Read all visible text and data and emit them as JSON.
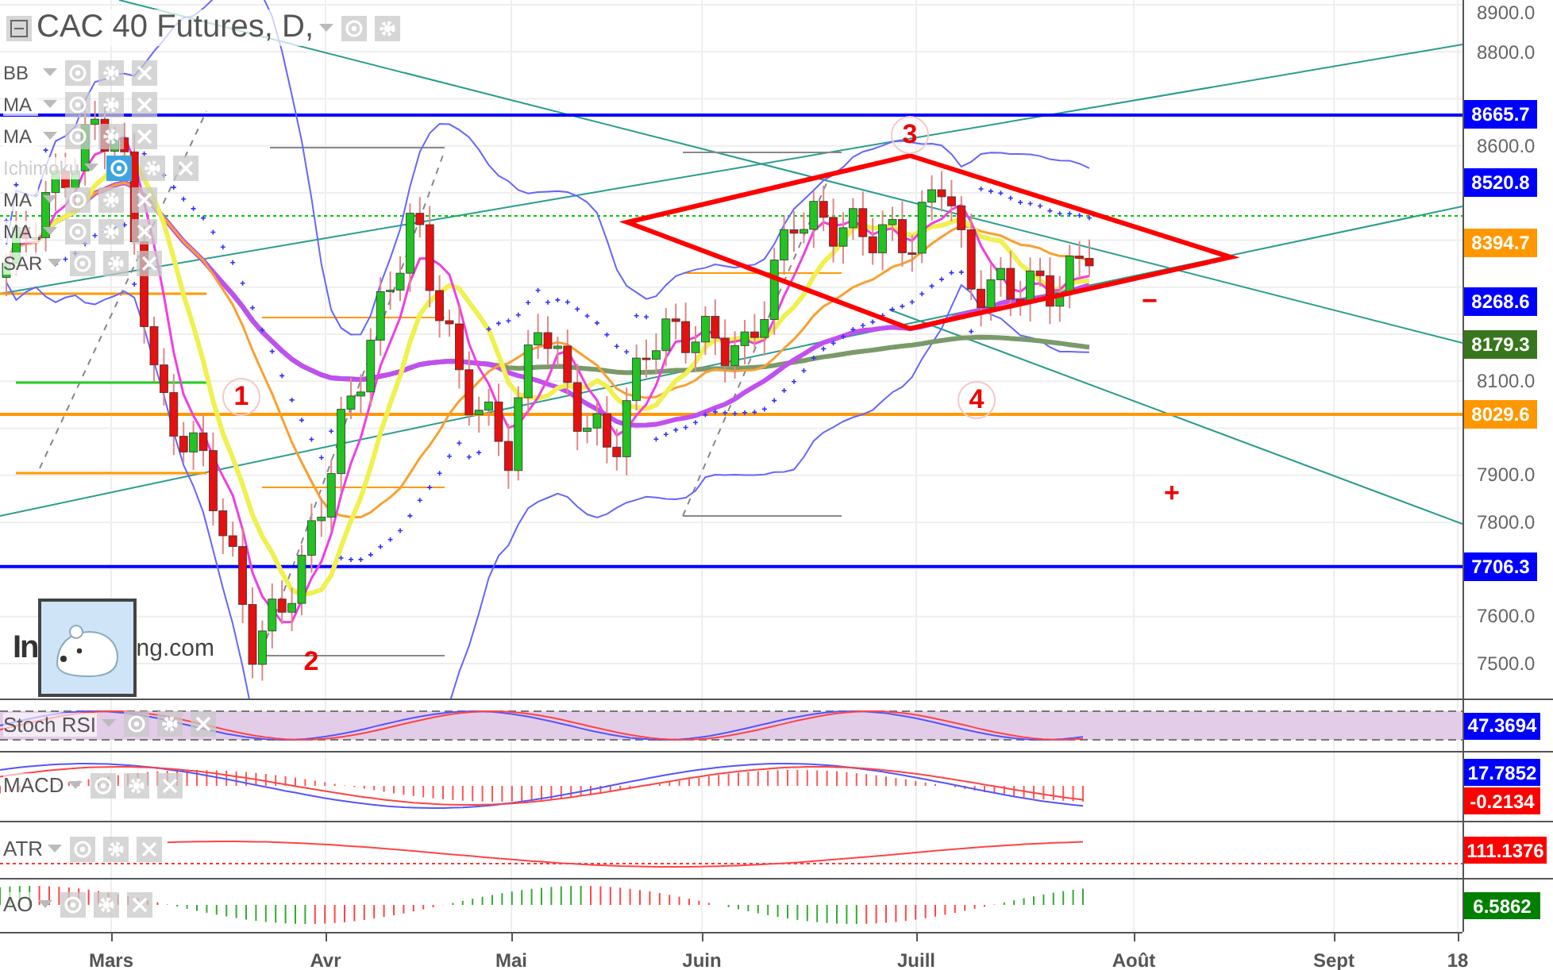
{
  "title": "CAC 40 Futures, D,",
  "legend": [
    {
      "label": "BB",
      "hidden": false
    },
    {
      "label": "MA",
      "hidden": false
    },
    {
      "label": "MA",
      "hidden": false
    },
    {
      "label": "Ichimoku",
      "hidden": true
    },
    {
      "label": "MA",
      "hidden": false
    },
    {
      "label": "MA",
      "hidden": false
    },
    {
      "label": "SAR",
      "hidden": false
    }
  ],
  "price_axis": [
    "8900.0",
    "8800.0",
    "8600.0",
    "8100.0",
    "7900.0",
    "7800.0",
    "7600.0",
    "7500.0"
  ],
  "price_tags": [
    {
      "value": "8665.7",
      "color": "#0000ff"
    },
    {
      "value": "8520.8",
      "color": "#0000ff"
    },
    {
      "value": "8394.7",
      "color": "#ff9800"
    },
    {
      "value": "8268.6",
      "color": "#0000ff"
    },
    {
      "value": "8179.3",
      "color": "#38761d"
    },
    {
      "value": "8029.6",
      "color": "#ff9800"
    },
    {
      "value": "7706.3",
      "color": "#0000ff"
    }
  ],
  "pattern_labels": [
    {
      "text": "1",
      "kind": "circled"
    },
    {
      "text": "2",
      "kind": "plain"
    },
    {
      "text": "3",
      "kind": "circled"
    },
    {
      "text": "4",
      "kind": "circled"
    },
    {
      "text": "−",
      "kind": "plain"
    },
    {
      "text": "+",
      "kind": "plain"
    }
  ],
  "logo": {
    "left": "In",
    "right": "ng.com"
  },
  "indicators": [
    {
      "name": "Stoch RSI",
      "tags": [
        {
          "value": "47.3694",
          "color": "#0000ff"
        }
      ]
    },
    {
      "name": "MACD",
      "tags": [
        {
          "value": "17.7852",
          "color": "#0000ff"
        },
        {
          "value": "-0.2134",
          "color": "#ff0000"
        }
      ]
    },
    {
      "name": "ATR",
      "tags": [
        {
          "value": "111.1376",
          "color": "#ff0000"
        }
      ]
    },
    {
      "name": "AO",
      "tags": [
        {
          "value": "6.5862",
          "color": "#008000"
        }
      ]
    }
  ],
  "time_axis": [
    "Mars",
    "Avr",
    "Mai",
    "Juin",
    "Juill",
    "Août",
    "Sept",
    "18"
  ]
}
